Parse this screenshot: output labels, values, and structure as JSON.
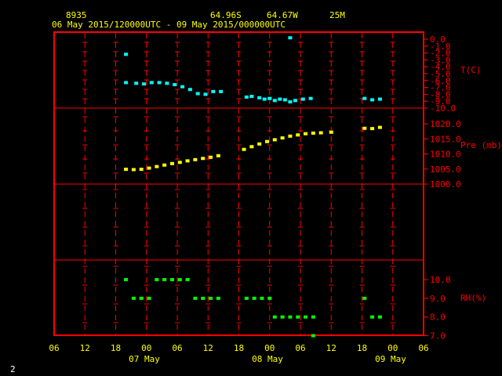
{
  "header": {
    "station": "8935",
    "lat": "64.96S",
    "lon": "64.67W",
    "elev": "25M",
    "range": "06 May 2015/120000UTC - 09 May 2015/000000UTC"
  },
  "footer_label": "2",
  "x_tick_labels": [
    "06",
    "12",
    "18",
    "00",
    "06",
    "12",
    "18",
    "00",
    "06",
    "12",
    "18",
    "00",
    "06"
  ],
  "date_labels": [
    "07 May",
    "08 May",
    "09 May"
  ],
  "colors": {
    "frame": "#ff0000",
    "text": "#ffff00",
    "temp": "#00ffff",
    "pres": "#ffff00",
    "rh": "#00ff00"
  },
  "chart_data": {
    "type": "scatter",
    "x_unit": "hours since 06 May 2015 06 UTC",
    "x_range": [
      0,
      72
    ],
    "panels": [
      {
        "name": "T(C)",
        "color": "#00ffff",
        "ylim": [
          -10,
          0
        ],
        "ticks": [
          "0.0",
          "-1.0",
          "-2.0",
          "-3.0",
          "-4.0",
          "-5.0",
          "-6.0",
          "-7.0",
          "-8.0",
          "-9.0",
          "-10.0"
        ],
        "x": [
          14,
          14,
          16,
          17.5,
          19,
          20.5,
          22,
          23.5,
          25,
          26.5,
          28,
          29.5,
          31,
          32.5,
          37.5,
          38.5,
          40,
          41,
          42,
          43,
          44,
          45,
          46,
          47,
          48.5,
          50,
          60.5,
          62,
          63.5
        ],
        "y": [
          -2.2,
          -6.3,
          -6.4,
          -6.5,
          -6.3,
          -6.3,
          -6.4,
          -6.6,
          -6.9,
          -7.3,
          -7.9,
          -8.0,
          -7.6,
          -7.6,
          -8.4,
          -8.3,
          -8.5,
          -8.7,
          -8.6,
          -8.9,
          -8.7,
          -8.8,
          -9.1,
          -8.9,
          -8.7,
          -8.6,
          -8.6,
          -8.8,
          -8.7
        ],
        "extra_points": [
          {
            "x": 46,
            "y": 0.2
          }
        ]
      },
      {
        "name": "Pre (mb)",
        "color": "#ffff00",
        "ylim": [
          1000,
          1020
        ],
        "ticks": [
          "1020.0",
          "1015.0",
          "1010.0",
          "1005.0",
          "1000.0"
        ],
        "x": [
          14,
          15.5,
          17,
          18.5,
          20,
          21.5,
          23,
          24.5,
          26,
          27.5,
          29,
          30.5,
          32,
          37,
          38.5,
          40,
          41.5,
          43,
          44.5,
          46,
          47.5,
          49,
          50.5,
          52,
          54,
          60.5,
          62,
          63.5
        ],
        "y": [
          1004.9,
          1004.8,
          1004.9,
          1005.3,
          1005.8,
          1006.3,
          1006.8,
          1007.2,
          1007.7,
          1008.1,
          1008.5,
          1008.9,
          1009.4,
          1011.5,
          1012.4,
          1013.3,
          1014.1,
          1014.7,
          1015.3,
          1015.9,
          1016.3,
          1016.7,
          1016.9,
          1017.0,
          1017.2,
          1018.5,
          1018.4,
          1018.8
        ]
      },
      {
        "name": "RH(%)",
        "color": "#00ff00",
        "ylim": [
          7.0,
          10.0
        ],
        "ticks": [
          "10.0",
          "9.0",
          "8.0",
          "7.0"
        ],
        "x": [
          14,
          15.5,
          17,
          18.5,
          20,
          21.5,
          23,
          24.5,
          26,
          27.5,
          29,
          30.5,
          32,
          37.5,
          39,
          40.5,
          42,
          43,
          44.5,
          46,
          47.5,
          49,
          50.5,
          60.5,
          62,
          63.5
        ],
        "y": [
          10,
          9,
          9,
          9,
          10,
          10,
          10,
          10,
          10,
          9,
          9,
          9,
          9,
          9,
          9,
          9,
          9,
          8,
          8,
          8,
          8,
          8,
          8,
          9,
          8,
          8
        ],
        "extra_points": [
          {
            "x": 50.5,
            "y": 7.0
          }
        ]
      }
    ]
  }
}
